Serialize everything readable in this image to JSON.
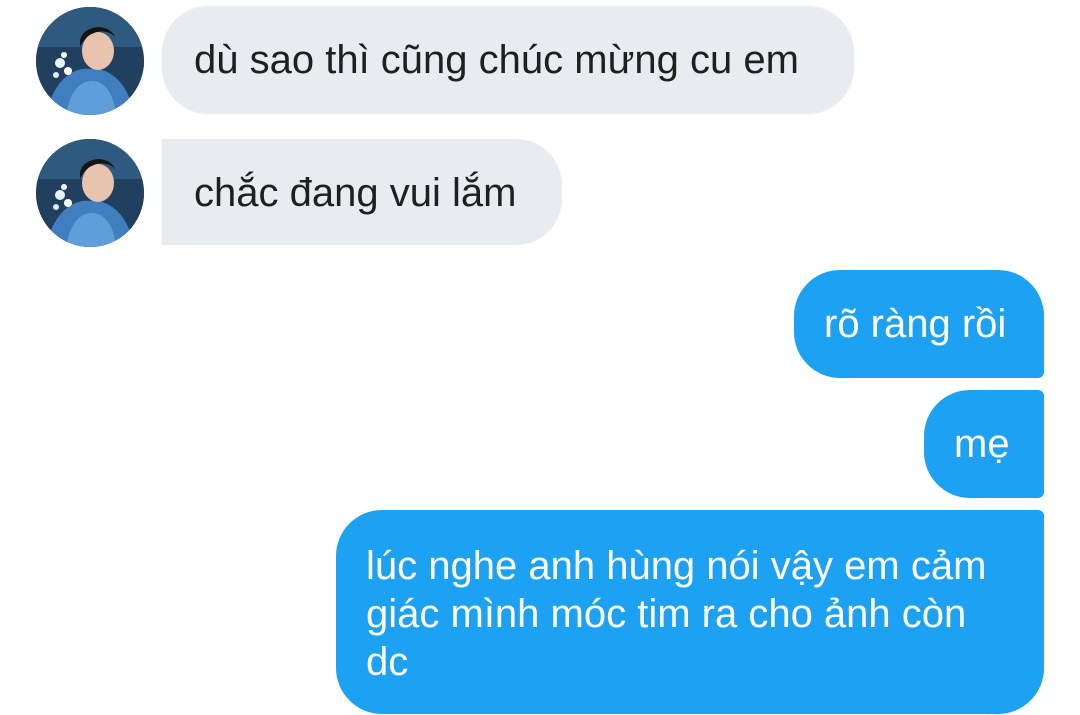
{
  "conversation": {
    "messages": [
      {
        "direction": "incoming",
        "text": "dù sao thì cũng chúc mừng cu em",
        "has_avatar": true
      },
      {
        "direction": "incoming",
        "text": "chắc đang vui lắm",
        "has_avatar": true
      },
      {
        "direction": "outgoing",
        "text": "rõ ràng rồi"
      },
      {
        "direction": "outgoing",
        "text": "mẹ"
      },
      {
        "direction": "outgoing",
        "text": "lúc nghe anh hùng nói vậy em cảm giác mình móc tim ra cho ảnh còn dc"
      }
    ]
  },
  "colors": {
    "incoming_bubble": "#e8ebef",
    "incoming_text": "#1f1f1f",
    "outgoing_bubble": "#1da1f2",
    "outgoing_text": "#ffffff",
    "background": "#ffffff"
  },
  "icons": {
    "avatar": "user-avatar-photo"
  }
}
